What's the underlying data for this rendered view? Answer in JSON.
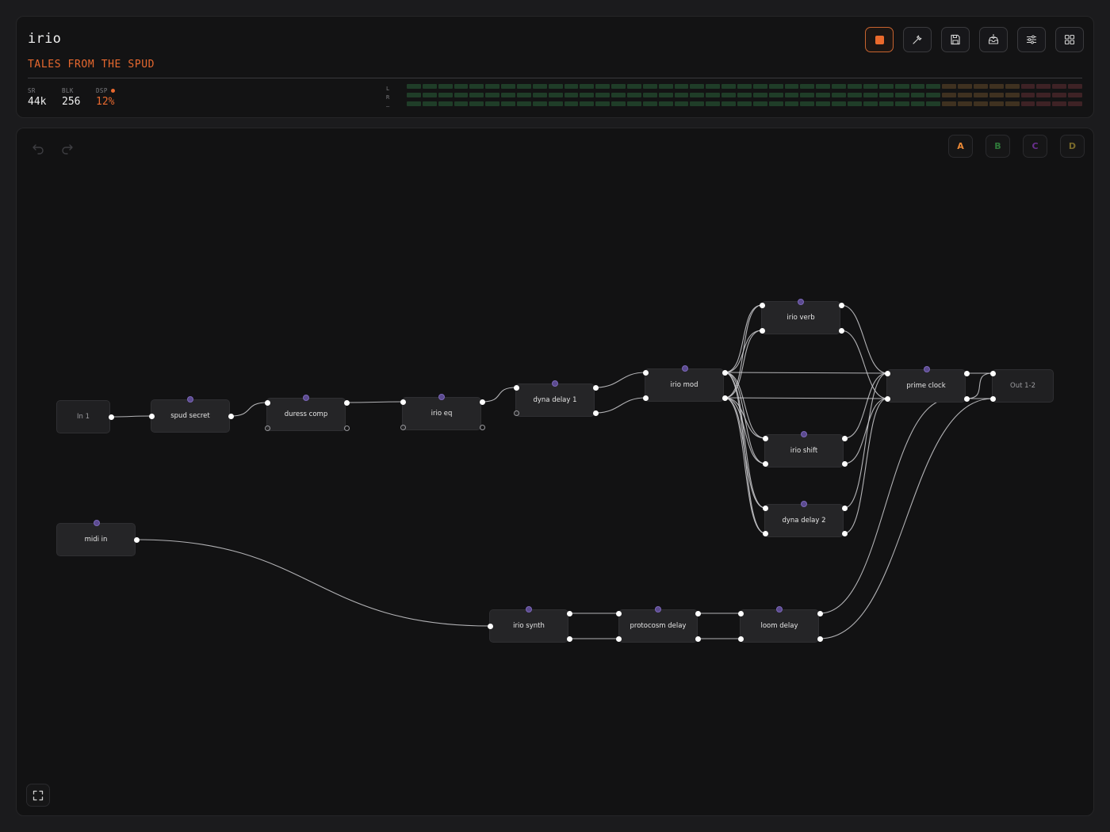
{
  "header": {
    "app_title": "irio",
    "project_title": "TALES FROM THE SPUD",
    "stats": [
      {
        "label": "SR",
        "value": "44k"
      },
      {
        "label": "BLK",
        "value": "256"
      },
      {
        "label": "DSP",
        "value": "12%"
      }
    ],
    "meter_labels": [
      "L",
      "R",
      "—"
    ],
    "meters": {
      "left_level": 0.77,
      "right_level": 0.77,
      "third_level": 0.77
    },
    "toolbar": [
      {
        "name": "stop-button",
        "icon": "stop-icon"
      },
      {
        "name": "wrench-button",
        "icon": "wrench-icon"
      },
      {
        "name": "save-button",
        "icon": "save-icon"
      },
      {
        "name": "load-button",
        "icon": "inbox-icon"
      },
      {
        "name": "settings-button",
        "icon": "sliders-icon"
      },
      {
        "name": "grid-button",
        "icon": "grid-icon"
      }
    ],
    "colors": {
      "accent": "#e8692f",
      "meter_green": "#1f3d28",
      "meter_amber": "#3f3120",
      "meter_red": "#3e2225"
    }
  },
  "canvas": {
    "scenes": [
      {
        "label": "A",
        "active": true,
        "color": "#ee8a36"
      },
      {
        "label": "B",
        "active": false,
        "color": "#2f7a3a"
      },
      {
        "label": "C",
        "active": false,
        "color": "#6a2f8f"
      },
      {
        "label": "D",
        "active": false,
        "color": "#7a6a2a"
      }
    ],
    "nodes": {
      "in1": "In 1",
      "spud_secret": "spud secret",
      "duress_comp": "duress comp",
      "irio_eq": "irio eq",
      "dyna_delay_1": "dyna delay 1",
      "irio_mod": "irio mod",
      "irio_verb": "irio verb",
      "irio_shift": "irio shift",
      "dyna_delay_2": "dyna delay 2",
      "prime_clock": "prime clock",
      "out12": "Out 1-2",
      "midi_in": "midi in",
      "irio_synth": "irio synth",
      "protocosm_delay": "protocosm delay",
      "loom_delay": "loom delay"
    }
  }
}
